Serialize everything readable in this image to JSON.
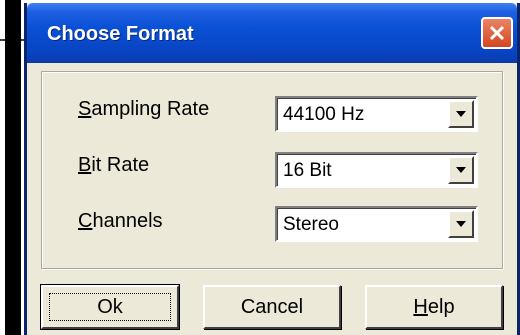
{
  "dialog": {
    "title": "Choose Format",
    "close_icon": "close-x-icon"
  },
  "fields": [
    {
      "label_mnemonic": "S",
      "label_rest": "ampling Rate",
      "value": "44100 Hz"
    },
    {
      "label_mnemonic": "B",
      "label_rest": "it Rate",
      "value": "16 Bit"
    },
    {
      "label_mnemonic": "C",
      "label_rest": "hannels",
      "value": "Stereo"
    }
  ],
  "buttons": {
    "ok": "Ok",
    "cancel": "Cancel",
    "help_mnemonic": "H",
    "help_rest": "elp"
  },
  "colors": {
    "titlebar": "#0a51d6",
    "dialog_bg": "#ece9d8",
    "close_button": "#d3461f"
  }
}
